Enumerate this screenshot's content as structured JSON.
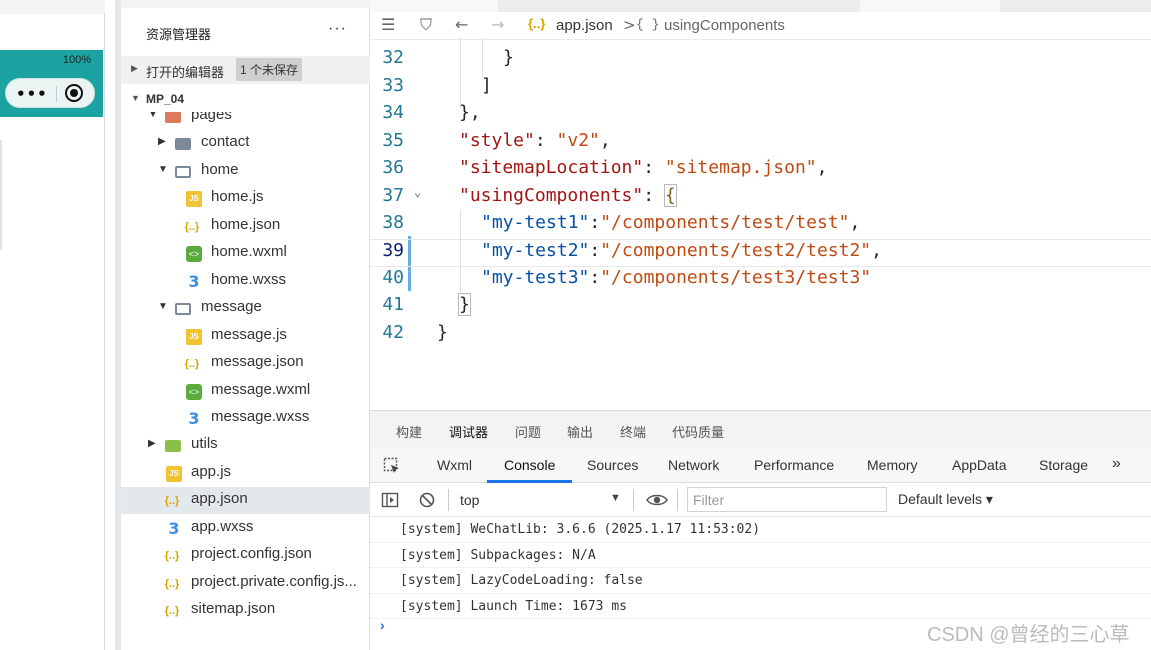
{
  "simulator": {
    "battery": "100%",
    "capsule_dots": "•••"
  },
  "explorer": {
    "title": "资源管理器",
    "more": "···",
    "open_editors_label": "打开的编辑器",
    "unsaved_badge": "1 个未保存",
    "root_label": "MP_04",
    "tree": [
      {
        "name": "pages",
        "icon": "folder-open-icon"
      },
      {
        "name": "contact",
        "icon": "folder-icon"
      },
      {
        "name": "home",
        "icon": "folder-open-icon"
      },
      {
        "name": "home.js",
        "icon": "js-file-icon"
      },
      {
        "name": "home.json",
        "icon": "json-file-icon"
      },
      {
        "name": "home.wxml",
        "icon": "wxml-file-icon"
      },
      {
        "name": "home.wxss",
        "icon": "wxss-file-icon"
      },
      {
        "name": "message",
        "icon": "folder-open-icon"
      },
      {
        "name": "message.js",
        "icon": "js-file-icon"
      },
      {
        "name": "message.json",
        "icon": "json-file-icon"
      },
      {
        "name": "message.wxml",
        "icon": "wxml-file-icon"
      },
      {
        "name": "message.wxss",
        "icon": "wxss-file-icon"
      },
      {
        "name": "utils",
        "icon": "folder-icon"
      },
      {
        "name": "app.js",
        "icon": "js-file-icon"
      },
      {
        "name": "app.json",
        "icon": "json-file-icon"
      },
      {
        "name": "app.wxss",
        "icon": "wxss-file-icon"
      },
      {
        "name": "project.config.json",
        "icon": "json-file-icon"
      },
      {
        "name": "project.private.config.js...",
        "icon": "json-file-icon"
      },
      {
        "name": "sitemap.json",
        "icon": "json-file-icon"
      }
    ]
  },
  "editor": {
    "breadcrumb": {
      "file_icon": "{..}",
      "file": "app.json",
      "separator": ">",
      "braces": "{ }",
      "item": "usingComponents"
    },
    "lines": [
      {
        "num": "32",
        "text": "}"
      },
      {
        "num": "33",
        "text": "]"
      },
      {
        "num": "34",
        "text": "},"
      },
      {
        "num": "35",
        "key": "\"style\"",
        "colon": ": ",
        "value": "\"v2\"",
        "tail": ","
      },
      {
        "num": "36",
        "key": "\"sitemapLocation\"",
        "colon": ": ",
        "value": "\"sitemap.json\"",
        "tail": ","
      },
      {
        "num": "37",
        "key": "\"usingComponents\"",
        "colon": ": ",
        "value": "{",
        "tail": ""
      },
      {
        "num": "38",
        "key": "\"my-test1\"",
        "colon": ":",
        "value": "\"/components/test/test\"",
        "tail": ","
      },
      {
        "num": "39",
        "key": "\"my-test2\"",
        "colon": ":",
        "value": "\"/components/test2/test2\"",
        "tail": ","
      },
      {
        "num": "40",
        "key": "\"my-test3\"",
        "colon": ":",
        "value": "\"/components/test3/test3\"",
        "tail": ""
      },
      {
        "num": "41",
        "text": "}"
      },
      {
        "num": "42",
        "text": "}"
      }
    ]
  },
  "panel": {
    "tabs": [
      "构建",
      "调试器",
      "问题",
      "输出",
      "终端",
      "代码质量"
    ],
    "devtools_tabs": [
      "Wxml",
      "Console",
      "Sources",
      "Network",
      "Performance",
      "Memory",
      "AppData",
      "Storage"
    ],
    "more_tabs": "»",
    "context": "top",
    "filter_placeholder": "Filter",
    "levels": "Default levels ▾",
    "logs": [
      "[system] WeChatLib: 3.6.6 (2025.1.17 11:53:02)",
      "[system] Subpackages: N/A",
      "[system] LazyCodeLoading: false",
      "[system] Launch Time: 1673 ms"
    ],
    "prompt": "›",
    "watermark": "CSDN @曾经的三心草"
  }
}
